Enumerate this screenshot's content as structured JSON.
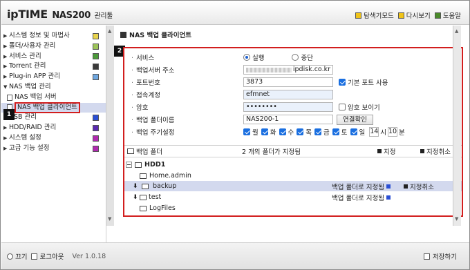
{
  "header": {
    "brand": "ipTIME",
    "model": "NAS200",
    "suffix": "관리툴",
    "links": [
      {
        "label": "탐색기모드",
        "icon": "explorer-mode-icon"
      },
      {
        "label": "다시보기",
        "icon": "refresh-icon"
      },
      {
        "label": "도움말",
        "icon": "help-icon"
      }
    ]
  },
  "sidebar": {
    "items": [
      {
        "label": "시스템 정보 및 마법사",
        "icon": "system-info-icon"
      },
      {
        "label": "폴더/사용자 관리",
        "icon": "folder-user-icon"
      },
      {
        "label": "서비스 관리",
        "icon": "service-icon"
      },
      {
        "label": "Torrent 관리",
        "icon": "torrent-icon"
      },
      {
        "label": "Plug-in APP 관리",
        "icon": "plugin-icon"
      },
      {
        "label": "NAS 백업 관리"
      },
      {
        "label": "NAS 백업 서버"
      },
      {
        "label": "NAS 백업 클라이언트"
      },
      {
        "label": "USB 관리",
        "icon": "usb-icon"
      },
      {
        "label": "HDD/RAID 관리",
        "icon": "hdd-icon"
      },
      {
        "label": "시스템 설정",
        "icon": "system-settings-icon"
      },
      {
        "label": "고급 기능 설정",
        "icon": "advanced-icon"
      }
    ],
    "badge": "1"
  },
  "main": {
    "title": "NAS 백업 클라이언트",
    "badge": "2",
    "form": {
      "service_label": "서비스",
      "service_on": "실행",
      "service_off": "중단",
      "server_addr_label": "백업서버 주소",
      "server_addr_domain": "ipdisk.co.kr",
      "port_label": "포트번호",
      "port_value": "3873",
      "default_port_label": "기본 포트 사용",
      "account_label": "접속계정",
      "account_value": "efmnet",
      "password_label": "암호",
      "password_value": "••••••••",
      "show_password_label": "암호 보이기",
      "folder_name_label": "백업 폴더이름",
      "folder_name_value": "NAS200-1",
      "connect_button": "연결확인",
      "period_label": "백업 주기설정",
      "days": [
        "월",
        "화",
        "수",
        "목",
        "금",
        "토",
        "일"
      ],
      "hour_value": "14",
      "hour_unit": "시",
      "minute_value": "10",
      "minute_unit": "분"
    },
    "folders": {
      "title": "백업 폴더",
      "count_text": "2 개의 폴더가 지정됨",
      "add_label": "지정",
      "remove_label": "지정취소",
      "tree": [
        {
          "label": "HDD1"
        },
        {
          "label": "Home.admin"
        },
        {
          "label": "backup",
          "status": "백업 폴더로 지정됨",
          "action": "지정취소"
        },
        {
          "label": "test",
          "status": "백업 폴더로 지정됨"
        },
        {
          "label": "LogFiles"
        }
      ]
    }
  },
  "footer": {
    "off_label": "끄기",
    "logout_label": "로그아웃",
    "version": "Ver 1.0.18",
    "save_label": "저장하기"
  }
}
